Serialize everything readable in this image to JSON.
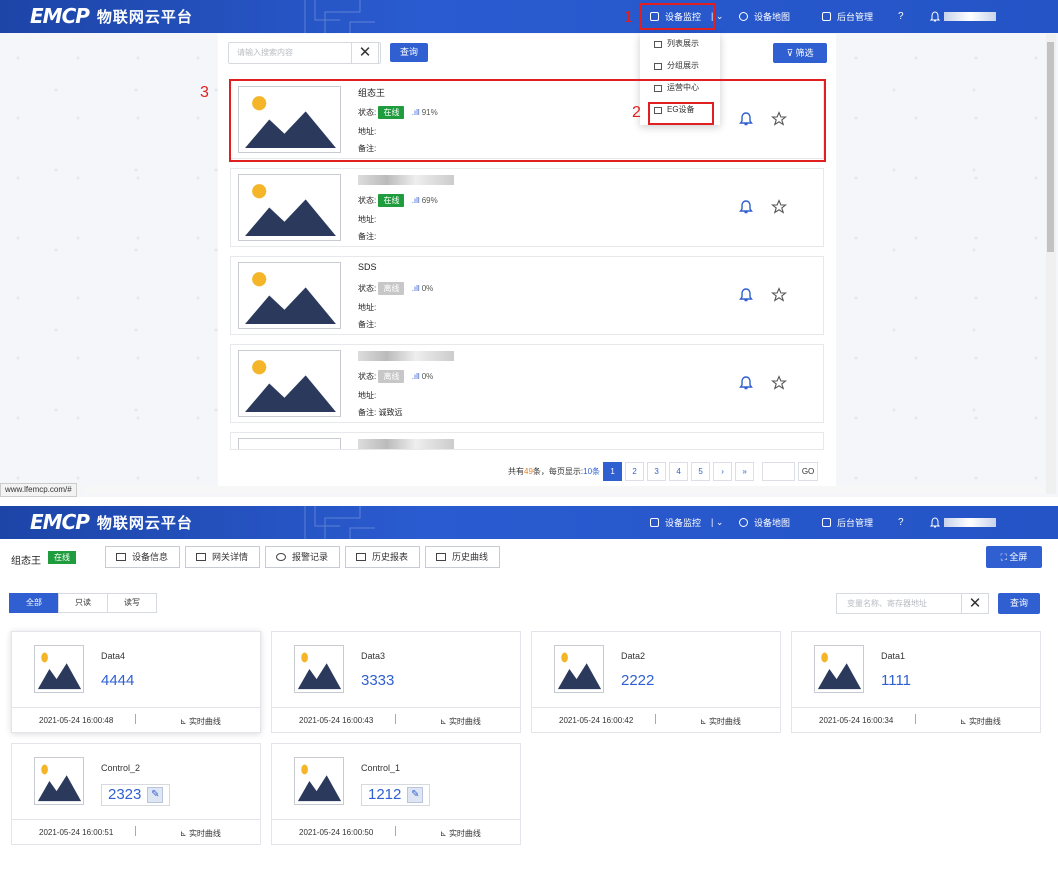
{
  "top": {
    "logo_mark": "EMCP",
    "logo_text": "物联网云平台",
    "nav_monitor": "设备监控",
    "nav_map": "设备地图",
    "nav_admin": "后台管理"
  },
  "list": {
    "search_placeholder": "请输入搜索内容",
    "clear": "✕",
    "query": "查询",
    "filter": "筛选",
    "status_label": "状态:",
    "address_label": "地址:",
    "remark_label": "备注:",
    "devices": [
      {
        "name": "组态王",
        "status": "在线",
        "online": true,
        "signal": "91%",
        "address": "",
        "remark": ""
      },
      {
        "name": "",
        "status": "在线",
        "online": true,
        "signal": "69%",
        "address": "",
        "remark": ""
      },
      {
        "name": "SDS",
        "status": "离线",
        "online": false,
        "signal": "0%",
        "address": "",
        "remark": ""
      },
      {
        "name": "",
        "status": "离线",
        "online": false,
        "signal": "0%",
        "address": "",
        "remark": "诚致远"
      }
    ],
    "pager": {
      "total_prefix": "共有",
      "total": "49",
      "total_mid": "条，每页显示:",
      "page_size": "10条",
      "pages": [
        "1",
        "2",
        "3",
        "4",
        "5"
      ],
      "next": "›",
      "last": "»",
      "go": "GO"
    }
  },
  "dropdown": [
    "列表展示",
    "分组展示",
    "运营中心",
    "EG设备"
  ],
  "annotations": [
    "1",
    "2",
    "3"
  ],
  "status_url": "www.lfemcp.com/#",
  "detail": {
    "device_name": "组态王",
    "device_status": "在线",
    "tabs": [
      "设备信息",
      "网关详情",
      "报警记录",
      "历史报表",
      "历史曲线"
    ],
    "fullscreen": "全屏",
    "filters": [
      "全部",
      "只读",
      "读写"
    ],
    "search_placeholder": "变量名称、寄存器地址",
    "clear": "✕",
    "query": "查询",
    "curve_label": "实时曲线",
    "vars": [
      {
        "name": "Data4",
        "value": "4444",
        "time": "2021-05-24 16:00:48",
        "editable": false
      },
      {
        "name": "Data3",
        "value": "3333",
        "time": "2021-05-24 16:00:43",
        "editable": false
      },
      {
        "name": "Data2",
        "value": "2222",
        "time": "2021-05-24 16:00:42",
        "editable": false
      },
      {
        "name": "Data1",
        "value": "1111",
        "time": "2021-05-24 16:00:34",
        "editable": false
      },
      {
        "name": "Control_2",
        "value": "2323",
        "time": "2021-05-24 16:00:51",
        "editable": true
      },
      {
        "name": "Control_1",
        "value": "1212",
        "time": "2021-05-24 16:00:50",
        "editable": true
      }
    ]
  },
  "colors": {
    "primary": "#2f5fd0",
    "online": "#1f9d3e",
    "offline": "#c7c7c7",
    "annotation": "#e02020"
  }
}
